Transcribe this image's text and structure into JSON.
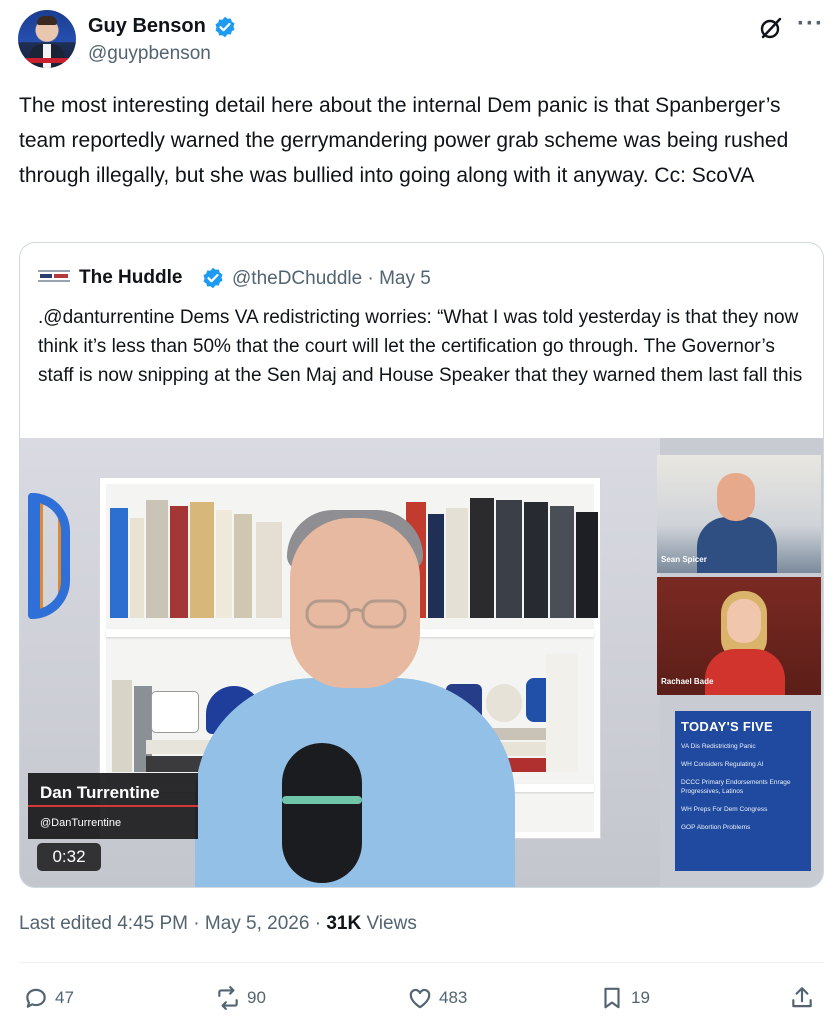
{
  "author": {
    "name": "Guy Benson",
    "handle": "@guypbenson"
  },
  "tweet": {
    "text": "The most interesting detail here about the internal Dem panic is that Spanberger’s team reportedly warned the gerrymandering power grab scheme was being rushed through illegally, but she was bullied into going along with it anyway. Cc: ScoVA"
  },
  "quote": {
    "name": "The Huddle",
    "handle_date": "@theDChuddle · May 5",
    "text": ".@danturrentine Dems VA redistricting worries: “What I was told yesterday is that they now think it’s less than 50% that the court will let the certification go through. The Governor’s staff is now snipping at the Sen Maj and House Speaker that they warned them last fall this"
  },
  "video": {
    "lower_third_name": "Dan Turrentine",
    "lower_third_handle": "@DanTurrentine",
    "timestamp": "0:32",
    "cam1_label": "Sean Spicer",
    "cam2_label": "Rachael Bade",
    "todays_five": {
      "title": "TODAY'S FIVE",
      "items": [
        "VA Dis Redistricting Panic",
        "WH Considers Regulating AI",
        "DCCC Primary Endorsements Enrage Progressives, Latinos",
        "WH Preps For Dem Congress",
        "GOP Abortion Problems"
      ]
    }
  },
  "meta": {
    "edited": "Last edited 4:45 PM · May 5, 2026 · ",
    "views_count": "31K",
    "views_label": " Views"
  },
  "actions": {
    "replies": "47",
    "reposts": "90",
    "likes": "483",
    "bookmarks": "19"
  },
  "icons": {
    "verified": "verified-badge-icon",
    "grok": "grok-icon",
    "more": "more-icon",
    "reply": "reply-icon",
    "repost": "repost-icon",
    "like": "like-icon",
    "bookmark": "bookmark-icon",
    "share": "share-icon"
  },
  "colors": {
    "accent": "#1d9bf0",
    "text": "#0f1419",
    "secondary": "#536471"
  }
}
